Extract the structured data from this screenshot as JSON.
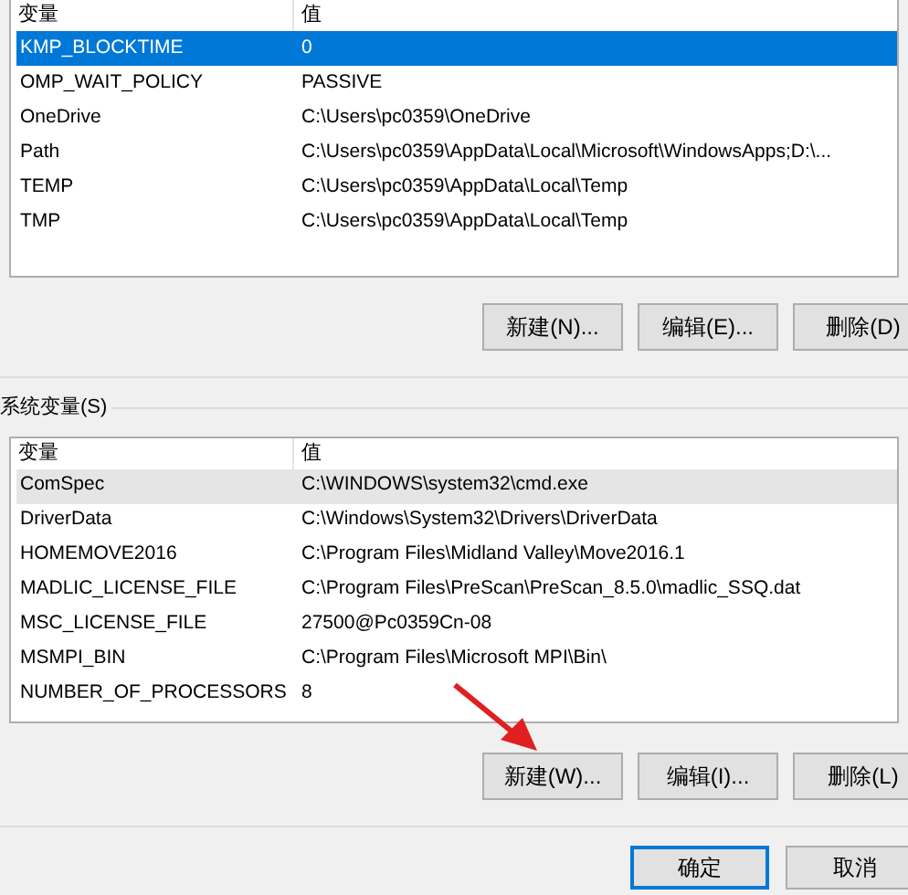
{
  "user_vars": {
    "focused": true,
    "columns": [
      "变量",
      "值"
    ],
    "rows": [
      {
        "name": "KMP_BLOCKTIME",
        "value": "0",
        "selected": true
      },
      {
        "name": "OMP_WAIT_POLICY",
        "value": "PASSIVE",
        "selected": false
      },
      {
        "name": "OneDrive",
        "value": "C:\\Users\\pc0359\\OneDrive",
        "selected": false
      },
      {
        "name": "Path",
        "value": "C:\\Users\\pc0359\\AppData\\Local\\Microsoft\\WindowsApps;D:\\...",
        "selected": false
      },
      {
        "name": "TEMP",
        "value": "C:\\Users\\pc0359\\AppData\\Local\\Temp",
        "selected": false
      },
      {
        "name": "TMP",
        "value": "C:\\Users\\pc0359\\AppData\\Local\\Temp",
        "selected": false
      }
    ],
    "buttons": [
      "新建(N)...",
      "编辑(E)...",
      "删除(D)"
    ]
  },
  "system_vars": {
    "label": "系统变量(S)",
    "focused": false,
    "columns": [
      "变量",
      "值"
    ],
    "rows": [
      {
        "name": "ComSpec",
        "value": "C:\\WINDOWS\\system32\\cmd.exe",
        "selected": true
      },
      {
        "name": "DriverData",
        "value": "C:\\Windows\\System32\\Drivers\\DriverData",
        "selected": false
      },
      {
        "name": "HOMEMOVE2016",
        "value": "C:\\Program Files\\Midland Valley\\Move2016.1",
        "selected": false
      },
      {
        "name": "MADLIC_LICENSE_FILE",
        "value": "C:\\Program Files\\PreScan\\PreScan_8.5.0\\madlic_SSQ.dat",
        "selected": false
      },
      {
        "name": "MSC_LICENSE_FILE",
        "value": "27500@Pc0359Cn-08",
        "selected": false
      },
      {
        "name": "MSMPI_BIN",
        "value": "C:\\Program Files\\Microsoft MPI\\Bin\\",
        "selected": false
      },
      {
        "name": "NUMBER_OF_PROCESSORS",
        "value": "8",
        "selected": false
      }
    ],
    "buttons": [
      "新建(W)...",
      "编辑(I)...",
      "删除(L)"
    ]
  },
  "dialog_buttons": [
    {
      "label": "确定",
      "default": true
    },
    {
      "label": "取消",
      "default": false
    }
  ]
}
